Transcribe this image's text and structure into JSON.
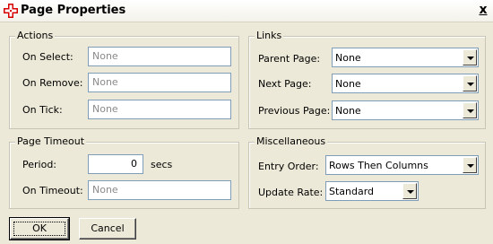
{
  "window": {
    "title": "Page Properties",
    "close_label": "x"
  },
  "actions": {
    "legend": "Actions",
    "on_select": {
      "label": "On Select:",
      "value": "None"
    },
    "on_remove": {
      "label": "On Remove:",
      "value": "None"
    },
    "on_tick": {
      "label": "On Tick:",
      "value": "None"
    }
  },
  "links": {
    "legend": "Links",
    "parent_page": {
      "label": "Parent Page:",
      "value": "None"
    },
    "next_page": {
      "label": "Next Page:",
      "value": "None"
    },
    "previous_page": {
      "label": "Previous Page:",
      "value": "None"
    }
  },
  "page_timeout": {
    "legend": "Page Timeout",
    "period": {
      "label": "Period:",
      "value": "0",
      "unit": "secs"
    },
    "on_timeout": {
      "label": "On Timeout:",
      "value": "None"
    }
  },
  "misc": {
    "legend": "Miscellaneous",
    "entry_order": {
      "label": "Entry Order:",
      "value": "Rows Then Columns"
    },
    "update_rate": {
      "label": "Update Rate:",
      "value": "Standard"
    }
  },
  "buttons": {
    "ok": "OK",
    "cancel": "Cancel"
  },
  "icons": {
    "app_icon": "red-cross-icon",
    "dropdown": "chevron-down-icon"
  }
}
